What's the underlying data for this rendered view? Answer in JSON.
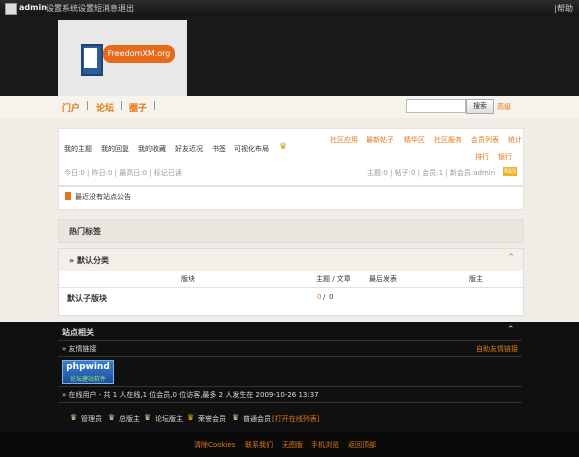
{
  "topbar": {
    "username": "admin",
    "links": [
      "设置",
      "系统设置",
      "短消息",
      "退出"
    ],
    "help": "|帮助"
  },
  "logo": {
    "text": "FreedomXM.org"
  },
  "nav": {
    "items": [
      "门户",
      "论坛",
      "圈子"
    ],
    "search_button": "搜索",
    "advanced": "高级"
  },
  "user_menu": {
    "left_links": [
      "我的主题",
      "我的回复",
      "我的收藏",
      "好友近况",
      "书签",
      "可视化布局"
    ],
    "right_links_row1": [
      "社区应用",
      "最新帖子",
      "精华区",
      "社区服务",
      "会员列表",
      "统计"
    ],
    "right_links_row2": [
      "排行",
      "银行"
    ]
  },
  "stats": {
    "left": "今日:0 | 昨日:0 | 最高日:0 | 标记已读",
    "right": "主题:0 | 帖子:0 | 会员:1 | 新会员:admin",
    "badge": "RSS"
  },
  "notice": "最近没有站点公告",
  "hot_tags": "热门标签",
  "forum": {
    "category": "» 默认分类",
    "columns": [
      "版块",
      "主题 / 文章",
      "最后发表",
      "版主"
    ],
    "rows": [
      {
        "name": "默认子版块",
        "topics": "0",
        "posts": "0"
      }
    ]
  },
  "footer": {
    "site_title": "站点相关",
    "links_title": "» 友情链接",
    "self_help": "自助友情链接",
    "phpwind_text": "phpwind",
    "phpwind_sub": "论坛建站软件",
    "online": "» 在线用户  - 共  1 人在线,1 位会员,0 位访客,最多  2 人发生在  2009-10-26 13:37",
    "roles": [
      "管理员",
      "总版主",
      "论坛版主",
      "荣誉会员",
      "普通会员"
    ],
    "open_list": "[打开在线列表]",
    "bottom_links": [
      "清除Cookies",
      "联系我们",
      "无图版",
      "手机浏览",
      "返回顶部"
    ]
  },
  "colors": {
    "accent": "#e0781a",
    "dark": "#1c1c1a",
    "light": "#efede6"
  }
}
